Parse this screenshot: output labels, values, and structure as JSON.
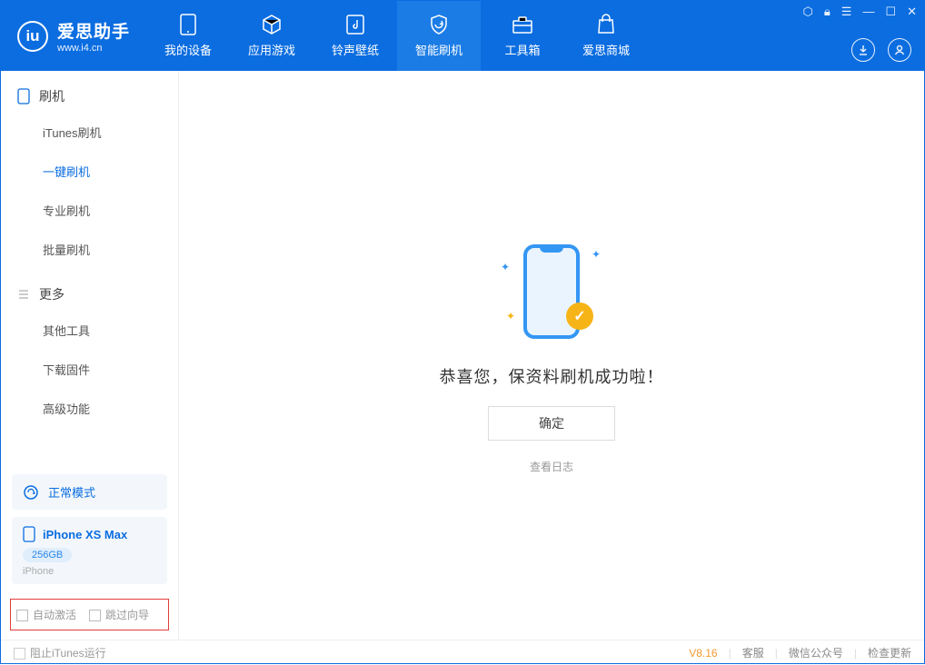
{
  "brand": {
    "title": "爱思助手",
    "sub": "www.i4.cn",
    "logo_letter": "iu"
  },
  "top_tabs": [
    {
      "label": "我的设备"
    },
    {
      "label": "应用游戏"
    },
    {
      "label": "铃声壁纸"
    },
    {
      "label": "智能刷机"
    },
    {
      "label": "工具箱"
    },
    {
      "label": "爱思商城"
    }
  ],
  "sidebar": {
    "section1": "刷机",
    "items1": [
      "iTunes刷机",
      "一键刷机",
      "专业刷机",
      "批量刷机"
    ],
    "section2": "更多",
    "items2": [
      "其他工具",
      "下载固件",
      "高级功能"
    ],
    "mode": "正常模式",
    "device": {
      "name": "iPhone XS Max",
      "storage": "256GB",
      "type": "iPhone"
    },
    "checks": {
      "auto_activate": "自动激活",
      "skip_guide": "跳过向导"
    }
  },
  "main": {
    "message": "恭喜您，保资料刷机成功啦！",
    "ok": "确定",
    "view_log": "查看日志"
  },
  "footer": {
    "block_itunes": "阻止iTunes运行",
    "version": "V8.16",
    "links": [
      "客服",
      "微信公众号",
      "检查更新"
    ]
  }
}
